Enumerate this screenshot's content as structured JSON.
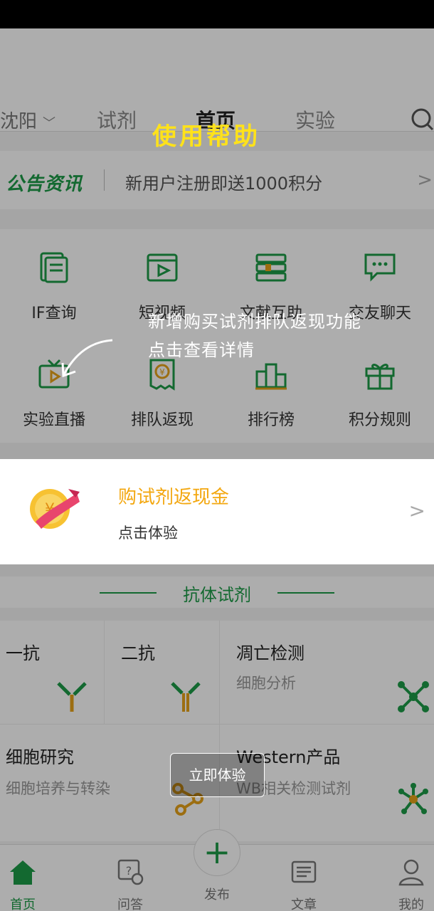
{
  "header": {
    "city": "沈阳",
    "tabs": [
      {
        "label": "试剂",
        "active": false
      },
      {
        "label": "首页",
        "active": true
      },
      {
        "label": "实验",
        "active": false
      }
    ]
  },
  "notice": {
    "brand": "公告资讯",
    "text": "新用户注册即送1000积分"
  },
  "features": [
    {
      "label": "IF查询",
      "icon": "document-icon"
    },
    {
      "label": "短视频",
      "icon": "video-play-icon"
    },
    {
      "label": "文献互助",
      "icon": "books-icon"
    },
    {
      "label": "交友聊天",
      "icon": "chat-icon"
    },
    {
      "label": "实验直播",
      "icon": "tv-live-icon"
    },
    {
      "label": "排队返现",
      "icon": "yen-receipt-icon"
    },
    {
      "label": "排行榜",
      "icon": "podium-icon"
    },
    {
      "label": "积分规则",
      "icon": "gift-icon"
    }
  ],
  "promo": {
    "title": "购试剂返现金",
    "subtitle": "点击体验"
  },
  "section": {
    "title": "抗体试剂"
  },
  "categories": [
    {
      "title": "一抗",
      "subtitle": ""
    },
    {
      "title": "二抗",
      "subtitle": ""
    },
    {
      "title": "凋亡检测",
      "subtitle": "细胞分析"
    },
    {
      "title": "细胞研究",
      "subtitle": "细胞培养与转染"
    },
    {
      "title": "Western产品",
      "subtitle": "WB相关检测试剂"
    }
  ],
  "tabbar": {
    "items": [
      {
        "label": "首页",
        "active": true
      },
      {
        "label": "问答",
        "active": false
      },
      {
        "label": "发布",
        "active": false
      },
      {
        "label": "文章",
        "active": false
      },
      {
        "label": "我的",
        "active": false
      }
    ]
  },
  "guide": {
    "title": "使用帮助",
    "hint_line1": "新增购买试剂排队返现功能",
    "hint_line2": "点击查看详情",
    "button": "立即体验"
  },
  "colors": {
    "brand_green": "#1c9b48",
    "promo_orange": "#f3a70f",
    "help_yellow": "#ffe21a"
  }
}
